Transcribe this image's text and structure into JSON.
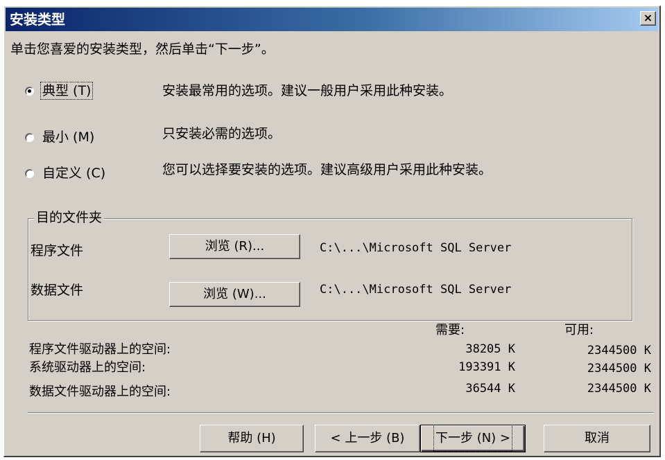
{
  "window": {
    "title": "安装类型",
    "close_label": "×"
  },
  "instruction": "单击您喜爱的安装类型，然后单击“下一步”。",
  "setup_types": [
    {
      "label": "典型 (T)",
      "description": "安装最常用的选项。建议一般用户采用此种安装。",
      "selected": true
    },
    {
      "label": "最小 (M)",
      "description": "只安装必需的选项。",
      "selected": false
    },
    {
      "label": "自定义 (C)",
      "description": "您可以选择要安装的选项。建议高级用户采用此种安装。",
      "selected": false
    }
  ],
  "destination": {
    "legend": "目的文件夹",
    "program_files": {
      "label": "程序文件",
      "button": "浏览 (R)...",
      "path": "C:\\...\\Microsoft SQL Server"
    },
    "data_files": {
      "label": "数据文件",
      "button": "浏览 (W)...",
      "path": "C:\\...\\Microsoft SQL Server"
    }
  },
  "space": {
    "required_header": "需要:",
    "available_header": "可用:",
    "rows": [
      {
        "label": "程序文件驱动器上的空间:",
        "required": "38205 K",
        "available": "2344500 K"
      },
      {
        "label": "系统驱动器上的空间:",
        "required": "193391 K",
        "available": "2344500 K"
      },
      {
        "label": "数据文件驱动器上的空间:",
        "required": "36544 K",
        "available": "2344500 K"
      }
    ]
  },
  "buttons": {
    "help": "帮助 (H)",
    "back": "< 上一步 (B)",
    "next": "下一步 (N) >",
    "cancel": "取消"
  },
  "colors": {
    "dialog_face": "#d4d0c8",
    "title_gradient_start": "#0a246a",
    "title_gradient_end": "#a6caf0"
  }
}
